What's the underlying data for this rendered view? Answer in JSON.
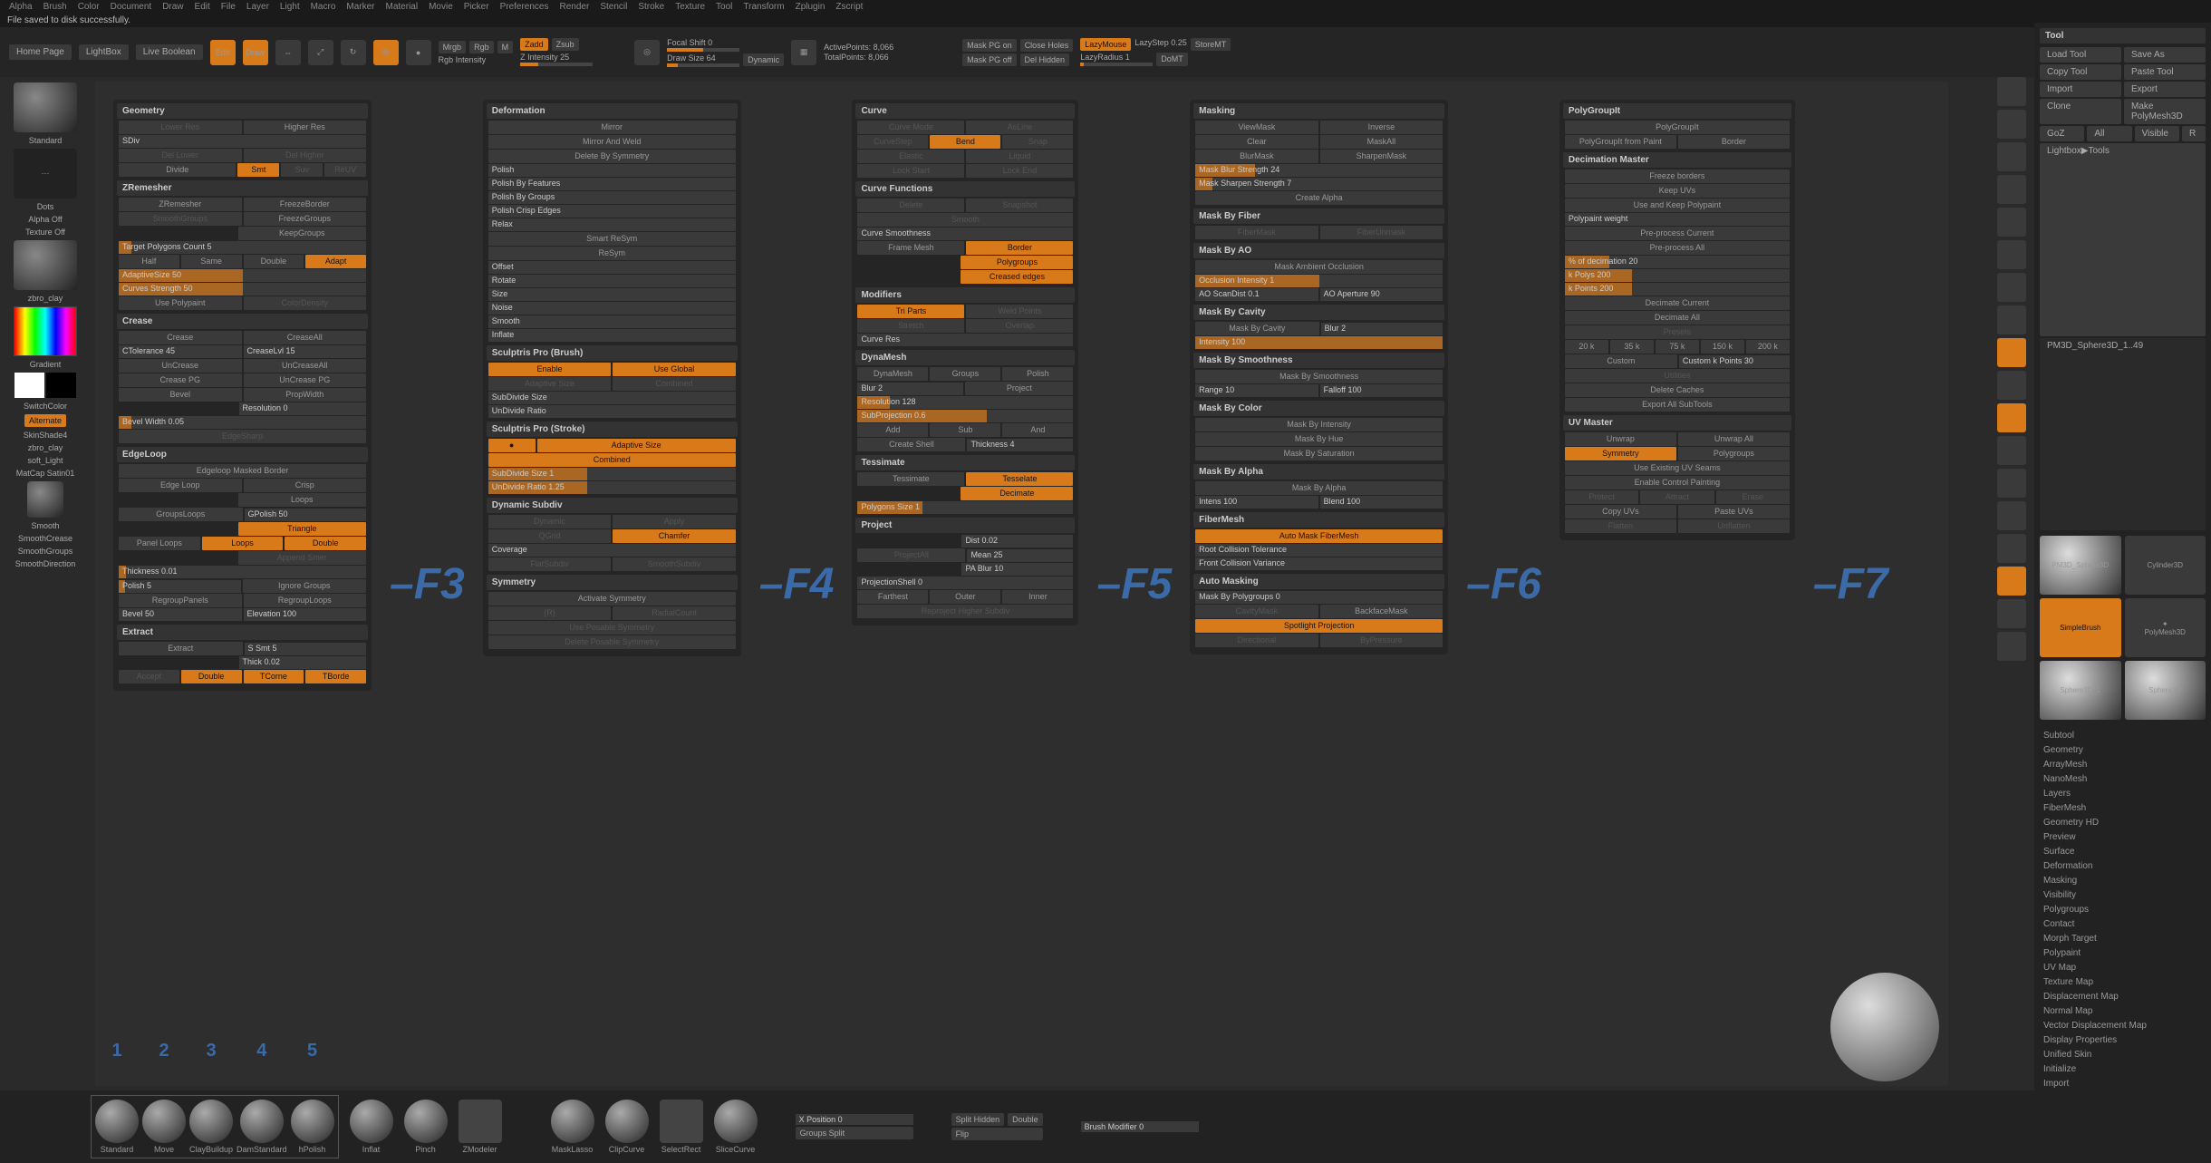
{
  "menubar": [
    "Alpha",
    "Brush",
    "Color",
    "Document",
    "Draw",
    "Edit",
    "File",
    "Layer",
    "Light",
    "Macro",
    "Marker",
    "Material",
    "Movie",
    "Picker",
    "Preferences",
    "Render",
    "Stencil",
    "Stroke",
    "Texture",
    "Tool",
    "Transform",
    "Zplugin",
    "Zscript"
  ],
  "status": "File saved to disk successfully.",
  "topbar": {
    "home": "Home Page",
    "lightbox": "LightBox",
    "liveBool": "Live Boolean",
    "edit": "Edit",
    "draw": "Draw",
    "mrg": "Mrgb",
    "rgb": "Rgb",
    "m": "M",
    "zadd": "Zadd",
    "zsub": "Zsub",
    "rgbInt": "Rgb Intensity",
    "zInt": "Z Intensity 25",
    "focal": "Focal Shift 0",
    "drawSize": "Draw Size 64",
    "dynamic": "Dynamic",
    "activePts": "ActivePoints: 8,066",
    "totalPts": "TotalPoints: 8,066",
    "maskOn": "Mask PG on",
    "closeHoles": "Close Holes",
    "maskOff": "Mask PG off",
    "delHidden": "Del Hidden",
    "lazy": "LazyMouse",
    "lazyStep": "LazyStep 0.25",
    "storeMT": "StoreMT",
    "lazyRad": "LazyRadius 1",
    "doMT": "DoMT"
  },
  "left": {
    "standard": "Standard",
    "dots": "Dots",
    "alphaOff": "Alpha Off",
    "texOff": "Texture Off",
    "zbroClay": "zbro_clay",
    "gradient": "Gradient",
    "switchColor": "SwitchColor",
    "alternate": "Alternate",
    "skinShade": "SkinShade4",
    "zbroClay2": "zbro_clay",
    "softLight": "soft_Light",
    "matcap": "MatCap Satin01",
    "smooth": "Smooth",
    "smoothCrease": "SmoothCrease",
    "smoothGroups": "SmoothGroups",
    "smoothDir": "SmoothDirection"
  },
  "p1": {
    "geo": "Geometry",
    "lowerRes": "Lower Res",
    "higherRes": "Higher Res",
    "sdiv": "SDiv",
    "delLower": "Del Lower",
    "delHigher": "Del Higher",
    "divide": "Divide",
    "smt": "Smt",
    "suv": "Suv",
    "reUV": "ReUV",
    "zrem": "ZRemesher",
    "zremBtn": "ZRemesher",
    "freezeBorder": "FreezeBorder",
    "freezeGroups": "FreezeGroups",
    "smoothGrps": "SmoothGroups",
    "keepGrps": "KeepGroups",
    "targetPoly": "Target Polygons Count 5",
    "half": "Half",
    "same": "Same",
    "double": "Double",
    "adapt": "Adapt",
    "adaptSize": "AdaptiveSize 50",
    "curvesStr": "Curves Strength 50",
    "usePolypaint": "Use Polypaint",
    "colorDens": "ColorDensity",
    "crease": "Crease",
    "creaseBtn": "Crease",
    "creaseAll": "CreaseAll",
    "cTol": "CTolerance 45",
    "creaseLvl": "CreaseLvl 15",
    "unCrease": "UnCrease",
    "unCreaseAll": "UnCreaseAll",
    "creasePG": "Crease PG",
    "unCreasePG": "UnCrease PG",
    "bevel": "Bevel",
    "propWidth": "PropWidth",
    "resolution": "Resolution 0",
    "bevelWidth": "Bevel Width 0.05",
    "edgeSharp": "EdgeSharp",
    "edgeLoop": "EdgeLoop",
    "elMasked": "Edgeloop Masked Border",
    "elBtn": "Edge Loop",
    "crisp": "Crisp",
    "loops": "Loops",
    "groupsLoops": "GroupsLoops",
    "gPolish": "GPolish 50",
    "triangle": "Triangle",
    "loopsBtn": "Loops",
    "doubleBtn": "Double",
    "panelLoops": "Panel Loops",
    "appendSmt": "Append Smer",
    "thickness": "Thickness 0.01",
    "polish": "Polish 5",
    "ignoreGroups": "Ignore Groups",
    "regroupPanels": "RegroupPanels",
    "regroupLoops": "RegroupLoops",
    "bevel50": "Bevel 50",
    "elevation": "Elevation 100",
    "extract": "Extract",
    "sSmt": "S Smt 5",
    "thick": "Thick 0.02",
    "accept": "Accept",
    "doubleEx": "Double",
    "tCorner": "TCorne",
    "tBorder": "TBorde"
  },
  "p2": {
    "def": "Deformation",
    "mirror": "Mirror",
    "mirrorWeld": "Mirror And Weld",
    "delSym": "Delete By Symmetry",
    "polish": "Polish",
    "polishFeat": "Polish By Features",
    "polishGroups": "Polish By Groups",
    "polishCrisp": "Polish Crisp Edges",
    "relax": "Relax",
    "smartResym": "Smart ReSym",
    "resym": "ReSym",
    "offset": "Offset",
    "rotate": "Rotate",
    "size": "Size",
    "noise": "Noise",
    "smooth": "Smooth",
    "inflate": "Inflate",
    "scBrush": "Sculptris Pro (Brush)",
    "enable": "Enable",
    "useGlobal": "Use Global",
    "adaptSize": "Adaptive Size",
    "combined": "Combined",
    "subDivSize": "SubDivide Size",
    "unDivRatio": "UnDivide Ratio",
    "scStroke": "Sculptris Pro (Stroke)",
    "adaptSizeS": "Adaptive Size",
    "combinedS": "Combined",
    "subDivSizeS": "SubDivide Size 1",
    "unDivRatioS": "UnDivide Ratio 1.25",
    "dynSubdiv": "Dynamic Subdiv",
    "dynamic": "Dynamic",
    "apply": "Apply",
    "qGrid": "QGrid",
    "chamfer": "Chamfer",
    "coverage": "Coverage",
    "flatSubdiv": "FlatSubdiv",
    "smoothSubdiv": "SmoothSubdiv",
    "symmetry": "Symmetry",
    "actSym": "Activate Symmetry",
    "r": "(R)",
    "radCount": "RadialCount",
    "usePosable": "Use Posable Symmetry",
    "delPosable": "Delete Posable Symmetry"
  },
  "p3": {
    "curve": "Curve",
    "curveMode": "Curve Mode",
    "asLine": "AsLine",
    "curveStep": "CurveStep",
    "bend": "Bend",
    "snap": "Snap",
    "elastic": "Elastic",
    "liquid": "Liquid",
    "lockStart": "Lock Start",
    "lockEnd": "Lock End",
    "curveFn": "Curve Functions",
    "delete": "Delete",
    "snapshot": "Snapshot",
    "smoothC": "Smooth",
    "curveSmooth": "Curve Smoothness",
    "frameMesh": "Frame Mesh",
    "border": "Border",
    "polygroups": "Polygroups",
    "creasedEdges": "Creased edges",
    "modifiers": "Modifiers",
    "triParts": "Tri Parts",
    "weldPoints": "Weld Points",
    "stretch": "Stretch",
    "overlap": "Overlap",
    "curveRes": "Curve Res",
    "dynamesh": "DynaMesh",
    "groups": "Groups",
    "polishD": "Polish",
    "blur": "Blur 2",
    "project": "Project",
    "res": "Resolution 128",
    "subProj": "SubProjection 0.6",
    "add": "Add",
    "sub": "Sub",
    "and": "And",
    "createShell": "Create Shell",
    "thick": "Thickness 4",
    "tess": "Tessimate",
    "tessBtn": "Tessimate",
    "tesselate": "Tesselate",
    "decimate": "Decimate",
    "polySize": "Polygons Size 1",
    "projSec": "Project",
    "dist": "Dist 0.02",
    "mean": "Mean 25",
    "paBlur": "PA Blur 10",
    "projAll": "ProjectAll",
    "projShell": "ProjectionShell 0",
    "farthest": "Farthest",
    "outer": "Outer",
    "inner": "Inner",
    "reproject": "Reproject Higher Subdiv"
  },
  "p4": {
    "masking": "Masking",
    "viewMask": "ViewMask",
    "inverse": "Inverse",
    "clear": "Clear",
    "maskAll": "MaskAll",
    "blurMask": "BlurMask",
    "sharpenMask": "SharpenMask",
    "maskBlurStr": "Mask Blur Strength 24",
    "maskSharpStr": "Mask Sharpen Strength 7",
    "createAlpha": "Create Alpha",
    "byFiber": "Mask By Fiber",
    "fiberMask": "FiberMask",
    "fiberUnmask": "FiberUnmask",
    "byAO": "Mask By AO",
    "maskAO": "Mask Ambient Occlusion",
    "occInt": "Occlusion Intensity 1",
    "aoScan": "AO ScanDist 0.1",
    "aoAper": "AO Aperture 90",
    "byCavity": "Mask By Cavity",
    "maskCav": "Mask By Cavity",
    "blur2": "Blur 2",
    "intensity": "Intensity 100",
    "bySmooth": "Mask By Smoothness",
    "maskSmooth": "Mask By Smoothness",
    "range": "Range 10",
    "falloff": "Falloff 100",
    "byColor": "Mask By Color",
    "maskInt": "Mask By Intensity",
    "maskHue": "Mask By Hue",
    "maskSat": "Mask By Saturation",
    "byAlpha": "Mask By Alpha",
    "maskAlpha": "Mask By Alpha",
    "intens": "Intens 100",
    "blend": "Blend 100",
    "fiberMesh": "FiberMesh",
    "autoMaskFM": "Auto Mask FiberMesh",
    "rootColTol": "Root Collision Tolerance",
    "frontColVar": "Front Collision Variance",
    "autoMask": "Auto Masking",
    "maskByPG": "Mask By Polygroups 0",
    "cavityMask": "CavityMask",
    "backfaceMask": "BackfaceMask",
    "spotlightProj": "Spotlight Projection",
    "directional": "Directional",
    "byPressure": "ByPressure"
  },
  "p5": {
    "pgIt": "PolyGroupIt",
    "pgItBtn": "PolyGroupIt",
    "pgItPaint": "PolyGroupIt from Paint",
    "border": "Border",
    "decMaster": "Decimation Master",
    "freezeBorders": "Freeze borders",
    "keepUVs": "Keep UVs",
    "useKeepPoly": "Use and Keep Polypaint",
    "polyWeight": "Polypaint weight",
    "preCurrent": "Pre-process Current",
    "preAll": "Pre-process All",
    "pctDec": "% of decimation 20",
    "kPolys": "k Polys 200",
    "kPoints": "k Points 200",
    "decCurrent": "Decimate Current",
    "decAll": "Decimate All",
    "presets": "Presets",
    "p20": "20 k",
    "p35": "35 k",
    "p75": "75 k",
    "p150": "150 k",
    "p200": "200 k",
    "custom": "Custom",
    "customK": "Custom k Points 30",
    "utilities": "Utilities",
    "delCaches": "Delete Caches",
    "exportAll": "Export All SubTools",
    "uvMaster": "UV Master",
    "unwrap": "Unwrap",
    "unwrapAll": "Unwrap All",
    "symmetry": "Symmetry",
    "polygroups": "Polygroups",
    "useSeams": "Use Existing UV Seams",
    "enableCP": "Enable Control Painting",
    "protect": "Protect",
    "attract": "Attract",
    "erase": "Erase",
    "copyUVs": "Copy UVs",
    "pasteUVs": "Paste UVs",
    "flatten": "Flatten",
    "unflatten": "Unflatten"
  },
  "right": {
    "tool": "Tool",
    "loadTool": "Load Tool",
    "saveAs": "Save As",
    "copyTool": "Copy Tool",
    "pasteTool": "Paste Tool",
    "import": "Import",
    "export": "Export",
    "clone": "Clone",
    "makePM3D": "Make PolyMesh3D",
    "goZ": "GoZ",
    "all": "All",
    "visible": "Visible",
    "r": "R",
    "lightbox": "Lightbox▶Tools",
    "pm3d": "PM3D_Sphere3D_1..49",
    "cyl": "Cylinder3D",
    "pm3dS": "PM3D_Sphere3D",
    "polyMesh": "PolyMesh3D",
    "simpleBrush": "SimpleBrush",
    "sphere3D": "Sphere3D",
    "sphere3D1": "Sphere3D_1",
    "pm3dS2": "PM3D_Sphere3D",
    "menu": [
      "Subtool",
      "Geometry",
      "ArrayMesh",
      "NanoMesh",
      "Layers",
      "FiberMesh",
      "Geometry HD",
      "Preview",
      "Surface",
      "Deformation",
      "Masking",
      "Visibility",
      "Polygroups",
      "Contact",
      "Morph Target",
      "Polypaint",
      "UV Map",
      "Texture Map",
      "Displacement Map",
      "Normal Map",
      "Vector Displacement Map",
      "Display Properties",
      "Unified Skin",
      "Initialize",
      "Import",
      "Export"
    ]
  },
  "bottom": {
    "brushes": [
      "Standard",
      "Move",
      "ClayBuildup",
      "DamStandard",
      "hPolish"
    ],
    "nums": [
      "1",
      "2",
      "3",
      "4",
      "5"
    ],
    "tools": [
      "Inflat",
      "Pinch",
      "ZModeler",
      "MaskLasso",
      "ClipCurve",
      "SelectRect",
      "SliceCurve"
    ],
    "xPos": "X Position 0",
    "grpSplit": "Groups Split",
    "splitHid": "Split Hidden",
    "double": "Double",
    "flip": "Flip",
    "brushMod": "Brush Modifier 0"
  },
  "fkeys": {
    "f3": "–F3",
    "f4": "–F4",
    "f5": "–F5",
    "f6": "–F6",
    "f7": "–F7"
  }
}
